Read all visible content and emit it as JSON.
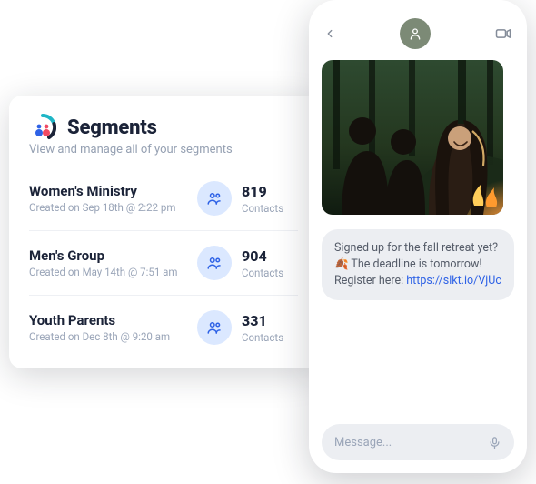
{
  "segments": {
    "title": "Segments",
    "subtitle": "View and manage all of your segments",
    "contacts_label": "Contacts",
    "items": [
      {
        "name": "Women's Ministry",
        "meta": "Created on Sep 18th @ 2:22 pm",
        "count": "819"
      },
      {
        "name": "Men's Group",
        "meta": "Created on May 14th @ 7:51 am",
        "count": "904"
      },
      {
        "name": "Youth Parents",
        "meta": "Created on Dec 8th @ 9:20 am",
        "count": "331"
      }
    ]
  },
  "chat": {
    "message_text_a": "Signed up for the fall retreat yet? 🍂 The deadline is tomorrow! Register here: ",
    "message_link": "https://slkt.io/VjUc",
    "input_placeholder": "Message..."
  }
}
